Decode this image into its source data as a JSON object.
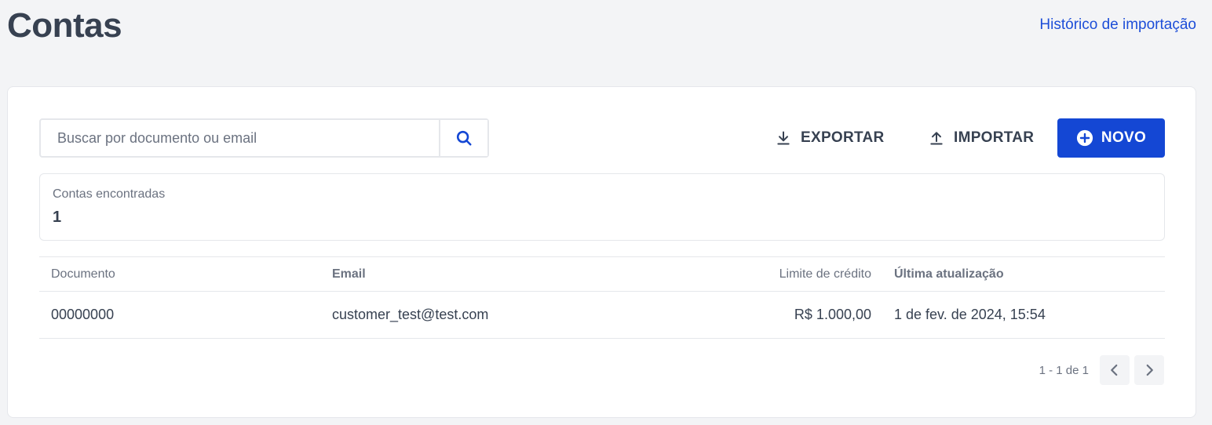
{
  "header": {
    "title": "Contas",
    "import_history_link": "Histórico de importação"
  },
  "toolbar": {
    "search_placeholder": "Buscar por documento ou email",
    "search_value": "",
    "export_label": "EXPORTAR",
    "import_label": "IMPORTAR",
    "new_label": "NOVO"
  },
  "summary": {
    "label": "Contas encontradas",
    "count": "1"
  },
  "table": {
    "columns": [
      "Documento",
      "Email",
      "Limite de crédito",
      "Última atualização"
    ],
    "rows": [
      [
        "00000000",
        "customer_test@test.com",
        "R$ 1.000,00",
        "1 de fev. de 2024, 15:54"
      ]
    ]
  },
  "pagination": {
    "info": "1 - 1 de 1"
  },
  "colors": {
    "accent": "#1447d4",
    "link": "#1d4ed8",
    "background": "#f3f4f6"
  },
  "icons": [
    "search-icon",
    "download-icon",
    "upload-icon",
    "plus-circle-icon",
    "chevron-left-icon",
    "chevron-right-icon"
  ]
}
